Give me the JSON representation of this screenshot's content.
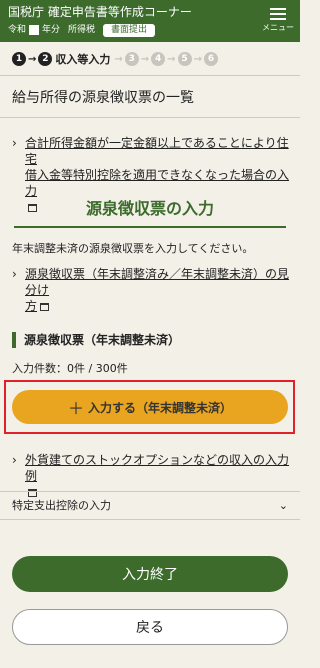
{
  "header": {
    "title": "国税庁 確定申告書等作成コーナー",
    "era": "令和",
    "year_suffix": "年分",
    "tax_type": "所得税",
    "print_button": "書面提出",
    "menu_label": "メニュー"
  },
  "steps": {
    "items": [
      "1",
      "2",
      "3",
      "4",
      "5",
      "6"
    ],
    "current_label": "収入等入力"
  },
  "page_title": "給与所得の源泉徴収票の一覧",
  "notice_link": {
    "line1": "合計所得金額が一定金額以上であることにより住宅",
    "line2": "借入金等特別控除を適用できなくなった場合の入力"
  },
  "section_title": "源泉徴収票の入力",
  "instruction": "年末調整未済の源泉徴収票を入力してください。",
  "howto_link": {
    "line1": "源泉徴収票（年末調整済み／年末調整未済）の見分け",
    "line2": "方"
  },
  "subsection": {
    "title": "源泉徴収票（年末調整未済）",
    "count_label": "入力件数：0件 / 300件",
    "input_button": "入力する（年末調整未済）"
  },
  "stock_option_link": "外貨建てのストックオプションなどの収入の入力例",
  "specific_expense": {
    "label": "特定支出控除の入力"
  },
  "finish_button": "入力終了",
  "back_button": "戻る",
  "colors": {
    "header_green": "#3c6b2c",
    "accent_orange": "#e9a420",
    "highlight_red": "#e0202a",
    "background": "#f3f0e8"
  }
}
